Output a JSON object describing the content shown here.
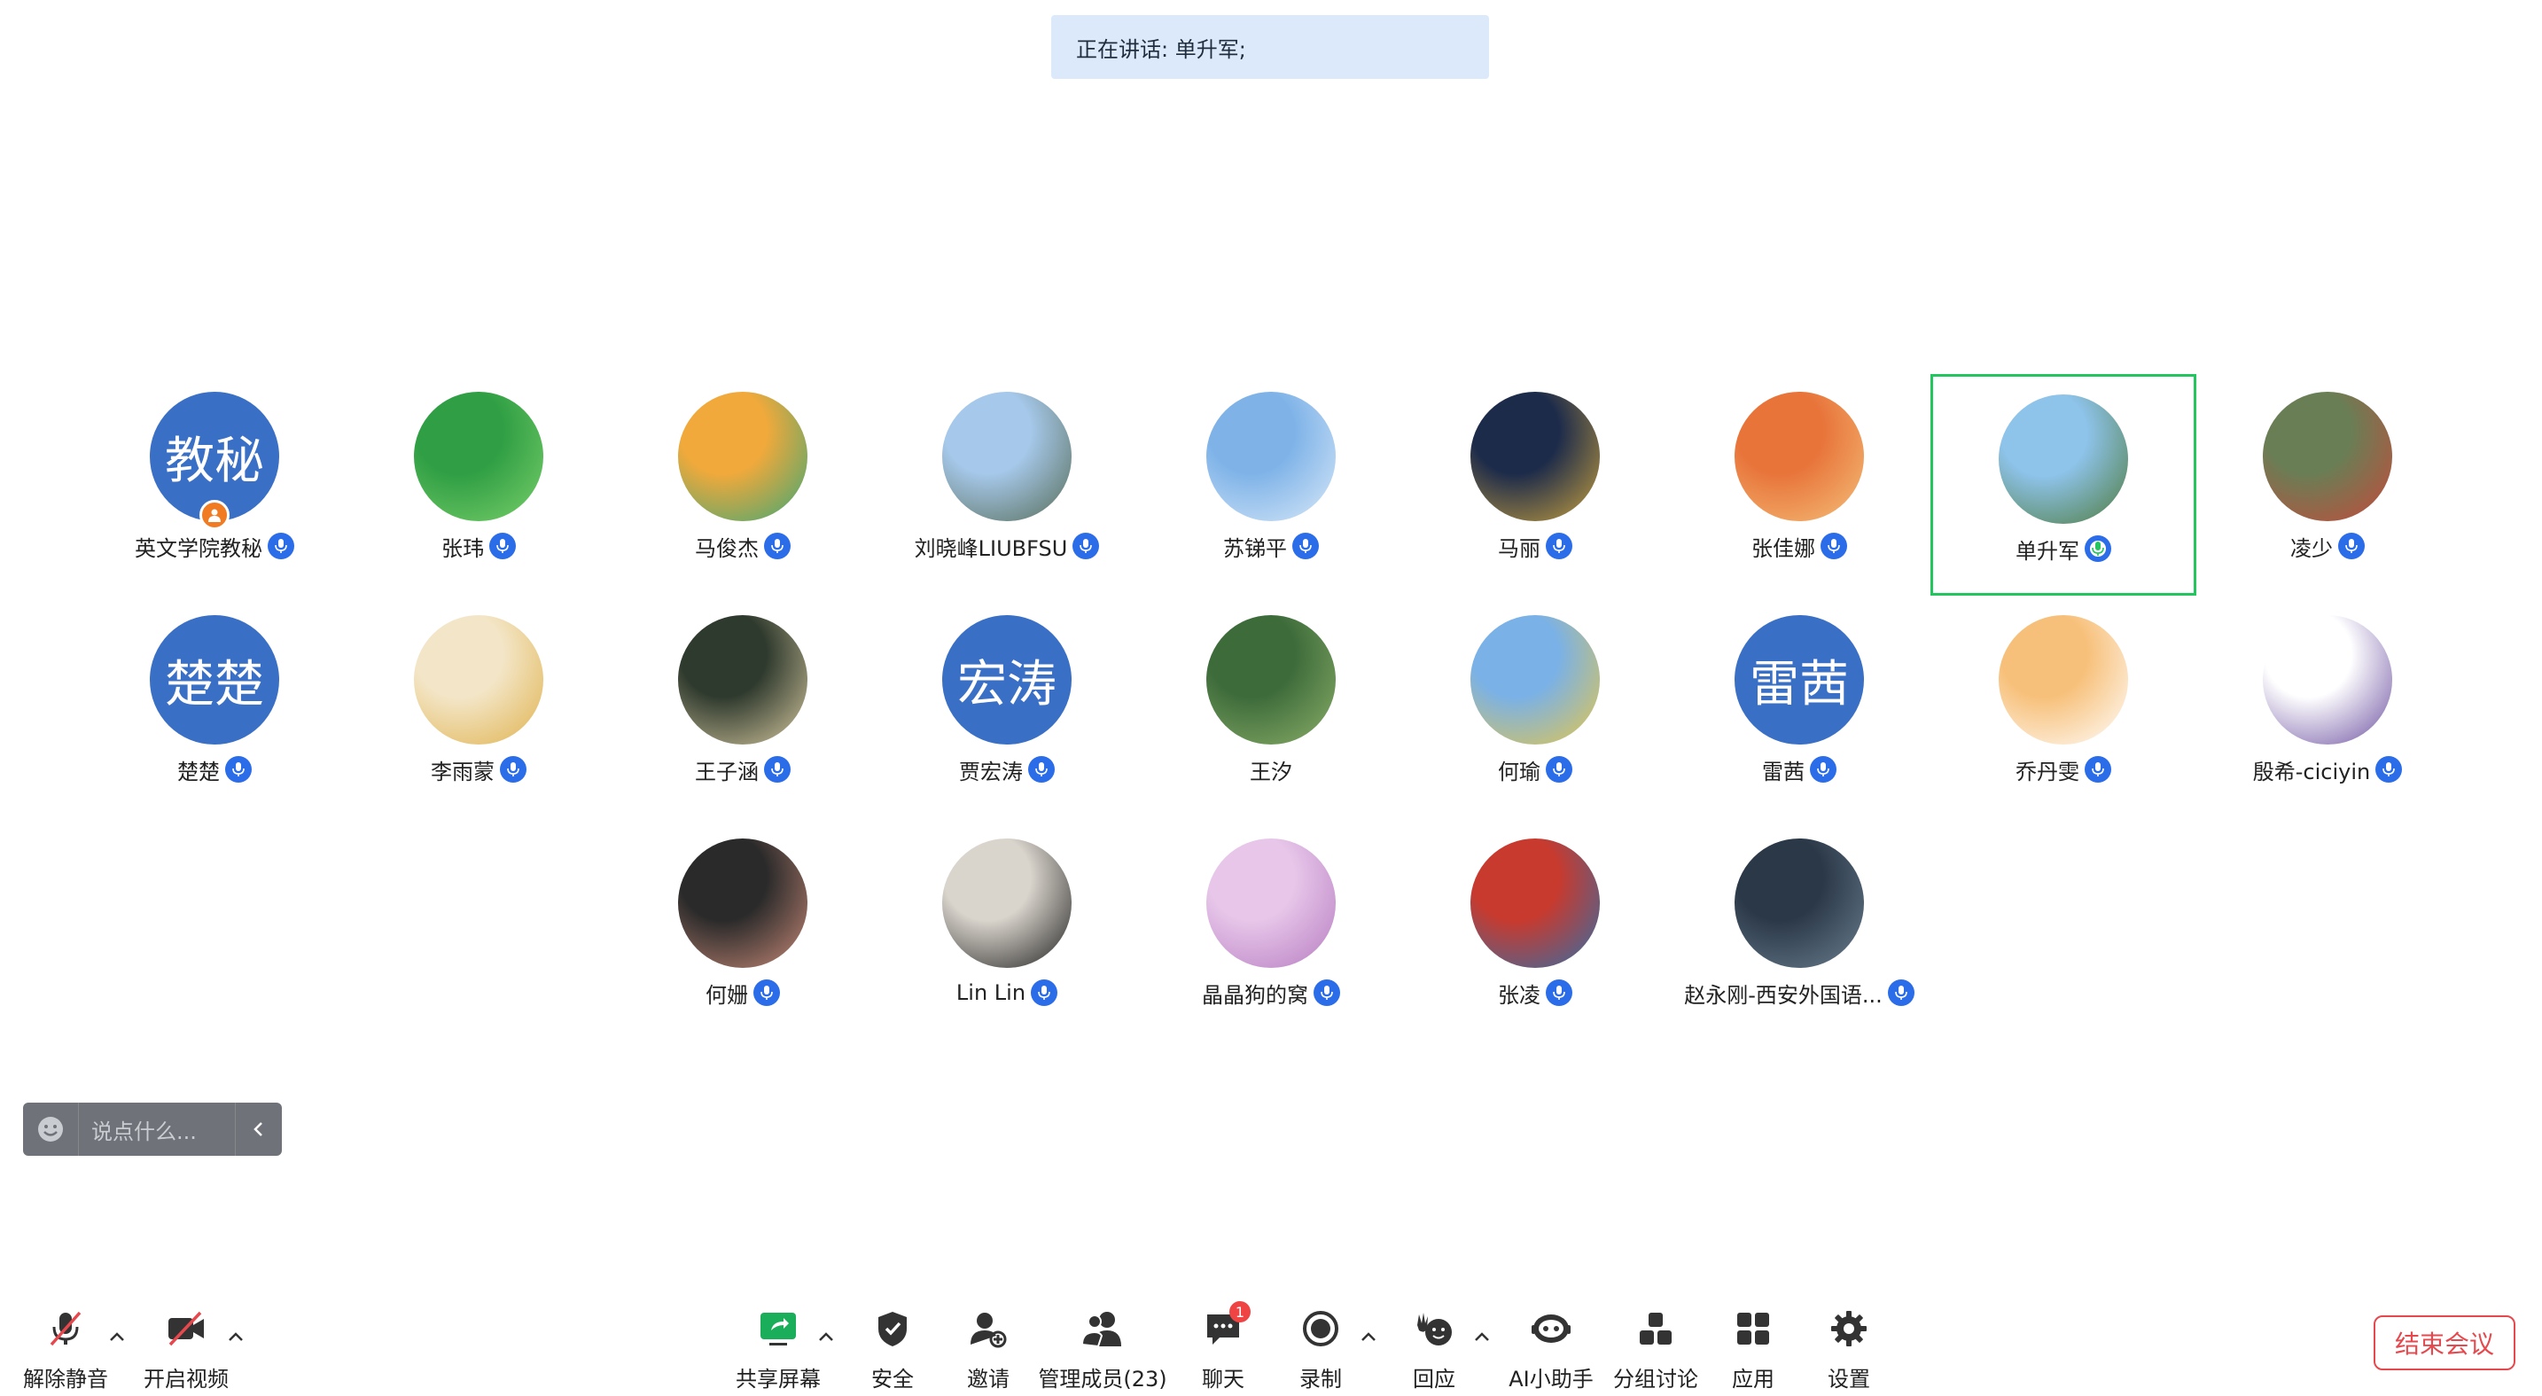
{
  "speaking_banner": {
    "text": "正在讲话: 单升军;"
  },
  "participants": [
    {
      "name": "英文学院教秘",
      "avatar_text": "教秘",
      "avatar_type": "text",
      "host": true
    },
    {
      "name": "张玮",
      "avatar_type": "image",
      "colors": [
        "#2f9e44",
        "#7ad06a"
      ]
    },
    {
      "name": "马俊杰",
      "avatar_type": "image",
      "colors": [
        "#f1a93b",
        "#3aa776"
      ]
    },
    {
      "name": "刘晓峰LIUBFSU",
      "avatar_type": "image",
      "colors": [
        "#a6c8ea",
        "#556b55"
      ]
    },
    {
      "name": "苏锑平",
      "avatar_type": "image",
      "colors": [
        "#7fb3e8",
        "#d9e9f8"
      ]
    },
    {
      "name": "马丽",
      "avatar_type": "image",
      "colors": [
        "#1d2b4a",
        "#c9a23f"
      ]
    },
    {
      "name": "张佳娜",
      "avatar_type": "image",
      "colors": [
        "#e8743a",
        "#f4c07a"
      ]
    },
    {
      "name": "单升军",
      "avatar_type": "image",
      "colors": [
        "#8ec3ea",
        "#4d7a3a"
      ],
      "speaking": true
    },
    {
      "name": "凌少",
      "avatar_type": "image",
      "colors": [
        "#6a7e55",
        "#c54a3b"
      ]
    },
    {
      "name": "楚楚",
      "avatar_text": "楚楚",
      "avatar_type": "text"
    },
    {
      "name": "李雨蒙",
      "avatar_type": "image",
      "colors": [
        "#f3e6c8",
        "#e0b24d"
      ]
    },
    {
      "name": "王子涵",
      "avatar_type": "image",
      "colors": [
        "#2f3a2e",
        "#d7c9a0"
      ]
    },
    {
      "name": "贾宏涛",
      "avatar_text": "宏涛",
      "avatar_type": "text"
    },
    {
      "name": "王汐",
      "avatar_type": "image",
      "colors": [
        "#3d6b3a",
        "#8cb06a"
      ],
      "no_mic": true
    },
    {
      "name": "何瑜",
      "avatar_type": "image",
      "colors": [
        "#7ab1e6",
        "#e5c74a"
      ]
    },
    {
      "name": "雷茜",
      "avatar_text": "雷茜",
      "avatar_type": "text"
    },
    {
      "name": "乔丹雯",
      "avatar_type": "image",
      "colors": [
        "#f7c07a",
        "#ffffff"
      ]
    },
    {
      "name": "殷希-ciciyin",
      "avatar_type": "image",
      "colors": [
        "#ffffff",
        "#6b4fa0"
      ]
    },
    {
      "name": "何姗",
      "avatar_type": "image",
      "colors": [
        "#2a2a2a",
        "#c98a78"
      ]
    },
    {
      "name": "Lin Lin",
      "avatar_type": "image",
      "colors": [
        "#d9d4cc",
        "#1f1f1f"
      ]
    },
    {
      "name": "晶晶狗的窝",
      "avatar_type": "image",
      "colors": [
        "#e7c6e9",
        "#b67cc1"
      ]
    },
    {
      "name": "张凌",
      "avatar_type": "image",
      "colors": [
        "#c83a2e",
        "#2f6fa8"
      ]
    },
    {
      "name": "赵永刚-西安外国语...",
      "avatar_type": "image",
      "colors": [
        "#2b3848",
        "#6b8090"
      ]
    }
  ],
  "chat_input": {
    "placeholder": "说点什么..."
  },
  "toolbar": {
    "unmute": "解除静音",
    "start_video": "开启视频",
    "share_screen": "共享屏幕",
    "security": "安全",
    "invite": "邀请",
    "manage_members": "管理成员(23)",
    "chat": "聊天",
    "chat_badge": "1",
    "record": "录制",
    "reaction": "回应",
    "ai_assistant": "AI小助手",
    "breakout": "分组讨论",
    "apps": "应用",
    "settings": "设置",
    "end_meeting": "结束会议"
  },
  "colors": {
    "accent": "#2b6de8",
    "speaking_border": "#22c55e",
    "end_button": "#e5484d",
    "share_green": "#1aad5a"
  }
}
